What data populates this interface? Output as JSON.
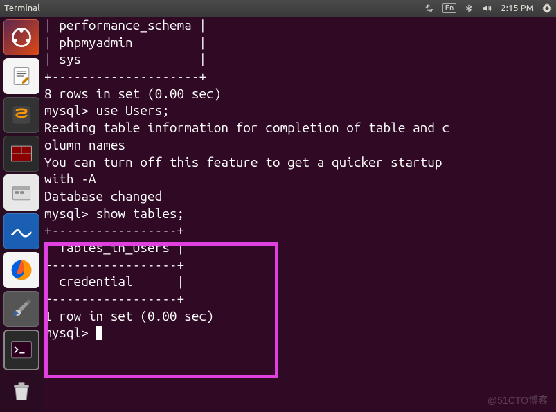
{
  "topbar": {
    "title": "Terminal",
    "language": "En",
    "time": "2:15 PM"
  },
  "terminal": {
    "lines": [
      "| performance_schema |",
      "| phpmyadmin         |",
      "| sys                |",
      "+--------------------+",
      "8 rows in set (0.00 sec)",
      "",
      "mysql> use Users;",
      "Reading table information for completion of table and c",
      "olumn names",
      "You can turn off this feature to get a quicker startup ",
      "with -A",
      "",
      "Database changed",
      "mysql> show tables;",
      "+-----------------+",
      "| Tables_in_Users |",
      "+-----------------+",
      "| credential      |",
      "+-----------------+",
      "1 row in set (0.00 sec)",
      "",
      "mysql> "
    ]
  },
  "watermark": "@51CTO博客"
}
